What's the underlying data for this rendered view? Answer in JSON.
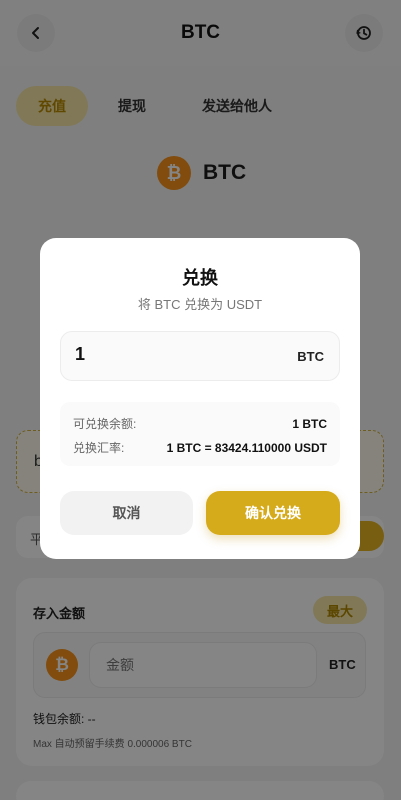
{
  "header": {
    "title": "BTC",
    "back_icon": "chevron-left-icon",
    "history_icon": "history-clock-icon"
  },
  "tabs": [
    {
      "label": "充值",
      "active": true
    },
    {
      "label": "提现",
      "active": false
    },
    {
      "label": "发送给他人",
      "active": false
    }
  ],
  "coin": {
    "symbol": "₿",
    "name": "BTC",
    "color": "#f7931a"
  },
  "background": {
    "address_text": "b",
    "info_label": "平"
  },
  "deposit": {
    "title": "存入金额",
    "max_label": "最大",
    "amount_placeholder": "金额",
    "unit": "BTC",
    "wallet_balance": "钱包余额: --",
    "max_fee": "Max 自动预留手续费 0.000006 BTC"
  },
  "modal": {
    "title": "兑换",
    "subtitle": "将 BTC 兑换为 USDT",
    "amount_value": "1",
    "amount_unit": "BTC",
    "available_label": "可兑换余额:",
    "available_value": "1 BTC",
    "rate_label": "兑换汇率:",
    "rate_value": "1 BTC = 83424.110000 USDT",
    "cancel_label": "取消",
    "confirm_label": "确认兑换"
  },
  "colors": {
    "accent": "#d6ab1b",
    "accent_soft": "#f5e7a8",
    "bitcoin": "#f7931a"
  }
}
